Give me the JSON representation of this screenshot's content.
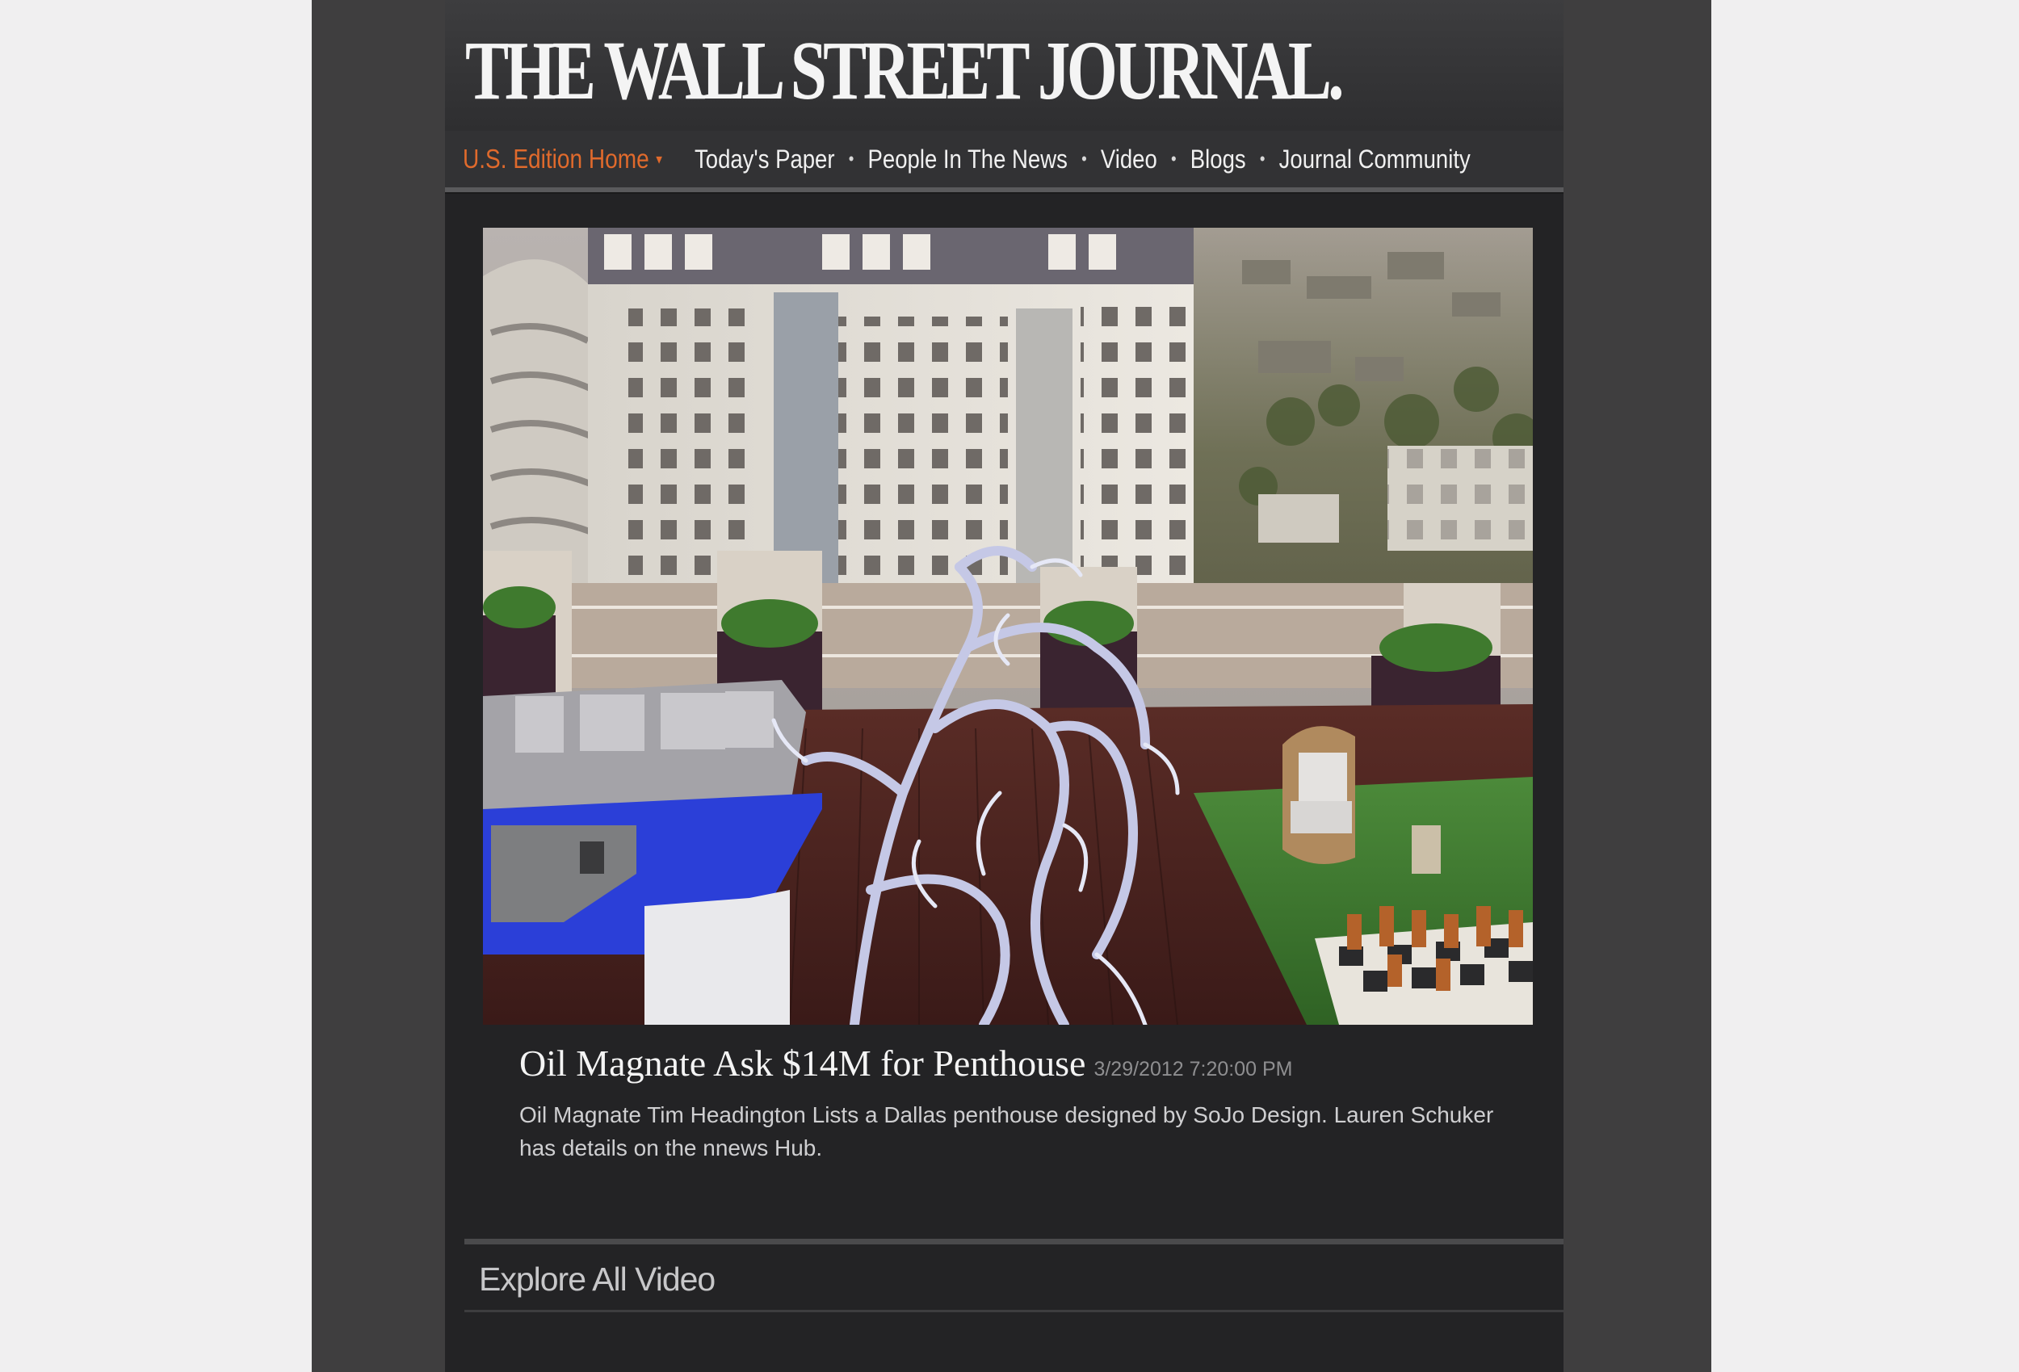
{
  "masthead": {
    "logo_text": "THE WALL STREET JOURNAL."
  },
  "nav": {
    "home_label": "U.S. Edition Home",
    "home_caret": "▾",
    "items": [
      "Today's Paper",
      "People In The News",
      "Video",
      "Blogs",
      "Journal Community"
    ],
    "separator": "•"
  },
  "video": {
    "headline": "Oil Magnate Ask $14M for Penthouse",
    "timestamp": "3/29/2012 7:20:00 PM",
    "summary": "Oil Magnate Tim Headington Lists a Dallas penthouse designed by SoJo Design.  Lauren Schuker has details on the nnews Hub."
  },
  "explore": {
    "label": "Explore All Video"
  },
  "colors": {
    "accent": "#e06a2c",
    "page_bg": "#232325",
    "frame_bg": "#3f3e3f"
  }
}
